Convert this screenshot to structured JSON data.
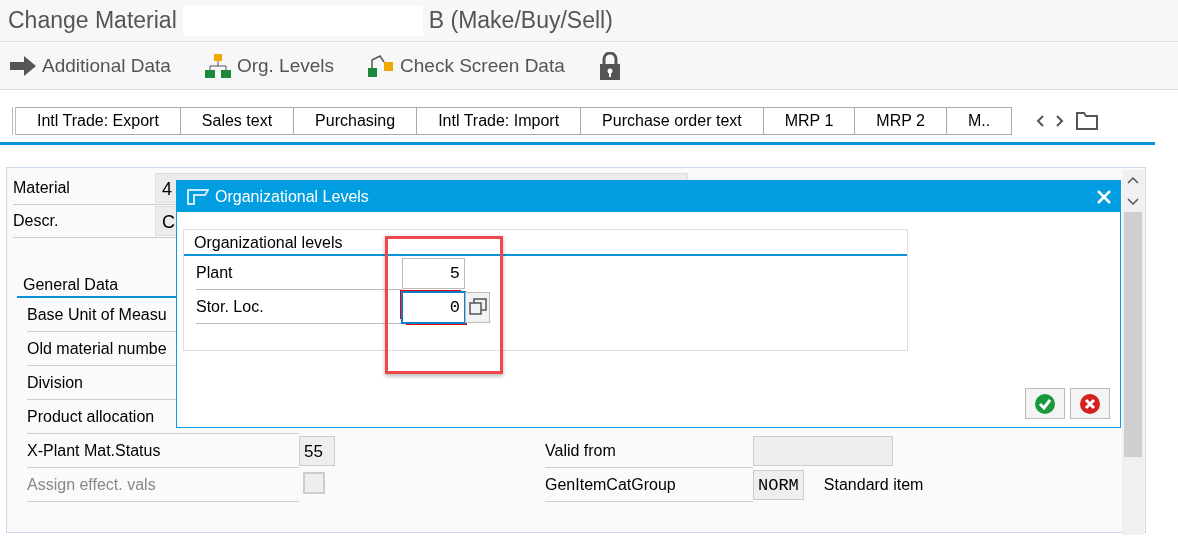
{
  "window": {
    "title_start": "Change Material",
    "title_end": "B (Make/Buy/Sell)"
  },
  "toolbar": [
    {
      "label": "Additional Data",
      "kind": "arrow"
    },
    {
      "label": "Org. Levels",
      "kind": "hierarchy"
    },
    {
      "label": "Check Screen Data",
      "kind": "check"
    },
    {
      "kind": "lock"
    }
  ],
  "tabs": [
    {
      "label": "Intl Trade: Export",
      "selected": false
    },
    {
      "label": "Sales text",
      "selected": false
    },
    {
      "label": "Purchasing",
      "selected": false
    },
    {
      "label": "Intl Trade: Import",
      "selected": false
    },
    {
      "label": "Purchase order text",
      "selected": false
    },
    {
      "label": "MRP 1",
      "selected": false
    },
    {
      "label": "MRP 2",
      "selected": false
    },
    {
      "label": "M..",
      "selected": false
    }
  ],
  "header_fields": [
    {
      "label": "Material",
      "value": "4"
    },
    {
      "label": "Descr.",
      "value": "C"
    }
  ],
  "general_data": {
    "title": "General Data",
    "rows": [
      {
        "label": "Base Unit of Measu",
        "kind": "field",
        "disabled": false
      },
      {
        "label": "Old material numbe",
        "kind": "field",
        "disabled": false
      },
      {
        "label": "Division",
        "kind": "field",
        "disabled": false
      },
      {
        "label": "Product allocation",
        "kind": "field",
        "disabled": false
      },
      {
        "label": "X-Plant Mat.Status",
        "kind": "field",
        "value": "55",
        "disabled": false,
        "right": {
          "label": "Valid from"
        }
      },
      {
        "label": "Assign effect. vals",
        "kind": "checkbox",
        "checked": false,
        "disabled": true,
        "right": {
          "label": "GenItemCatGroup",
          "value": "NORM",
          "note": "Standard item"
        }
      }
    ]
  },
  "dialog": {
    "title": "Organizational Levels",
    "group": "Organizational levels",
    "fields": [
      {
        "label": "Plant",
        "value": "5",
        "focused": false
      },
      {
        "label": "Stor. Loc.",
        "value": "0",
        "focused": true
      }
    ]
  }
}
